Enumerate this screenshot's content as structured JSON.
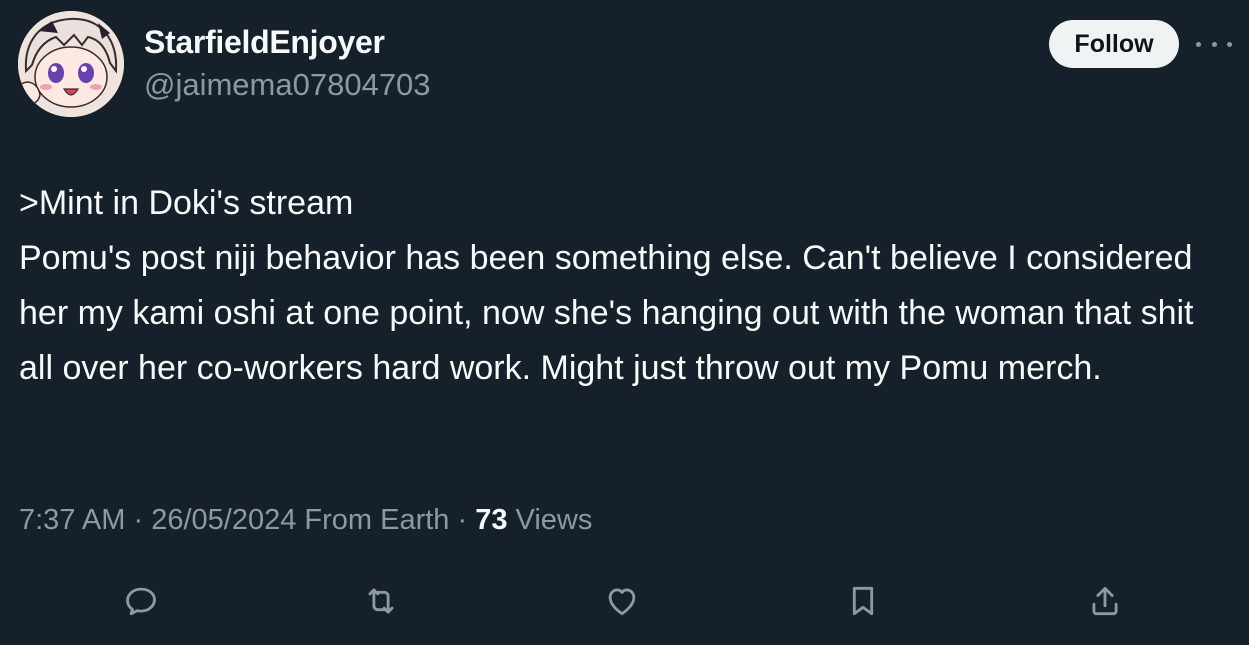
{
  "user": {
    "display_name": "StarfieldEnjoyer",
    "handle": "@jaimema07804703",
    "avatar_icon": "anime-avatar"
  },
  "follow": {
    "label": "Follow"
  },
  "tweet": {
    "lines": [
      ">Mint in Doki's stream",
      "Pomu's post niji behavior has been something else. Can't believe I considered her my kami oshi at one point, now she's hanging out with the woman that shit all over her co-workers hard work. Might just throw out my Pomu merch."
    ]
  },
  "meta": {
    "time": "7:37 AM",
    "sep1": " · ",
    "date": "26/05/2024",
    "location": " From Earth",
    "sep2": " · ",
    "views_count": "73",
    "views_label": " Views"
  },
  "actions": {
    "reply_icon": "reply-icon",
    "retweet_icon": "retweet-icon",
    "like_icon": "heart-icon",
    "bookmark_icon": "bookmark-icon",
    "share_icon": "share-icon"
  },
  "colors": {
    "background": "#15202b",
    "primary_text": "#f7f9f9",
    "secondary_text": "#8b98a5",
    "follow_bg": "#eff3f4"
  }
}
